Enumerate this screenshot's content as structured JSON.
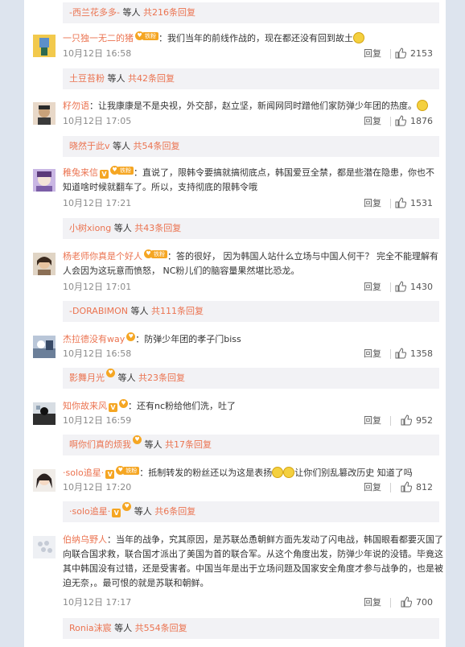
{
  "top_sub": {
    "name": "-西兰花多多-",
    "suffix": " 等人 ",
    "count": "共216条回复"
  },
  "reply_label": "回复",
  "comments": [
    {
      "name": "一只独一无二的猪",
      "badges": [
        "fans"
      ],
      "text1": "：我们当年的前线作战的，现在都还没有回到故土",
      "text2": "",
      "emoji_end": true,
      "time": "10月12日 16:58",
      "likes": "2153",
      "sub": {
        "name": "土豆苔粉",
        "suffix": " 等人 ",
        "count": "共42条回复"
      }
    },
    {
      "name": "籽勿语",
      "badges": [],
      "text1": "：让我康康是不是央视，外交部，赵立坚，新闻网同时蹭他们家防弹少年团的热度。",
      "text2": "",
      "emoji_end": true,
      "time": "10月12日 17:05",
      "likes": "1876",
      "sub": {
        "name": "晓然于此v",
        "suffix": " 等人 ",
        "count": "共54条回复"
      }
    },
    {
      "name": "稚兔来信",
      "badges": [
        "v",
        "fans"
      ],
      "text1": "：直说了，限韩令要搞就搞彻底点，韩国爱豆全禁，都是些潜在隐患，你也不",
      "text2": "知道啥时候就翻车了。所以，支持彻底的限韩令哦",
      "emoji_end": false,
      "time": "10月12日 17:21",
      "likes": "1531",
      "sub": {
        "name": "小树xiong",
        "suffix": " 等人 ",
        "count": "共43条回复"
      }
    },
    {
      "name": "杨老师你真是个好人",
      "badges": [
        "fans"
      ],
      "text1": "：答的很好， 因为韩国人站什么立场与中国人何干？ 完全不能理解有",
      "text2": "人会因为这玩意而愤怒， NC粉儿们的脑容量果然堪比恐龙。",
      "emoji_end": false,
      "time": "10月12日 17:01",
      "likes": "1430",
      "sub": {
        "name": "-DORABIMON",
        "suffix": " 等人 ",
        "count": "共111条回复"
      }
    },
    {
      "name": "杰拉德没有way",
      "badges": [
        "coin"
      ],
      "text1": "：防弹少年团的孝子门biss",
      "text2": "",
      "emoji_end": false,
      "time": "10月12日 16:58",
      "likes": "1358",
      "sub": {
        "name": "影舞月光",
        "subbadge": true,
        "suffix": " 等人 ",
        "count": "共23条回复"
      }
    },
    {
      "name": "知你故来风",
      "badges": [
        "v",
        "coin"
      ],
      "text1": "：还有nc粉给他们洗，吐了",
      "text2": "",
      "emoji_end": false,
      "time": "10月12日 16:59",
      "likes": "952",
      "sub": {
        "name": "啊你们真的烦我",
        "subbadge": true,
        "suffix": " 等人 ",
        "count": "共17条回复"
      }
    },
    {
      "name": "·solo追星·",
      "badges": [
        "v",
        "fans"
      ],
      "text1": "：抵制转发的粉丝还以为这是表扬",
      "text2": "",
      "text1b": "让你们别乱篡改历史 知道了吗",
      "emoji_mid": true,
      "time": "10月12日 17:20",
      "likes": "812",
      "sub": {
        "name": "·solo追星·",
        "subbadge": true,
        "subv": true,
        "suffix": " 等人 ",
        "count": "共6条回复"
      }
    },
    {
      "name": "伯纳乌野人",
      "badges": [],
      "text1": "：当年的战争，究其原因，是苏联怂恿朝鲜方面先发动了闪电战，韩国眼看都要灭国了",
      "text2": "向联合国求救，联合国才派出了美国为首的联合军。从这个角度出发，防弹少年说的没错。毕竟这",
      "text3": "其中韩国没有过错，还是受害者。中国当年是出于立场问题及国家安全角度才参与战争的，也是被",
      "text4": "迫无奈，。最可恨的就是苏联和朝鲜。",
      "emoji_end": false,
      "time": "10月12日 17:17",
      "likes": "700",
      "sub": {
        "name": "Ronia沫宸",
        "suffix": " 等人 ",
        "count": "共554条回复"
      }
    }
  ],
  "badge_text": "铁粉",
  "colors": {
    "link": "#eb7350",
    "badge": "#f5a623",
    "sub_bg": "#f2f2f5",
    "page_bg": "#dde4ee"
  }
}
